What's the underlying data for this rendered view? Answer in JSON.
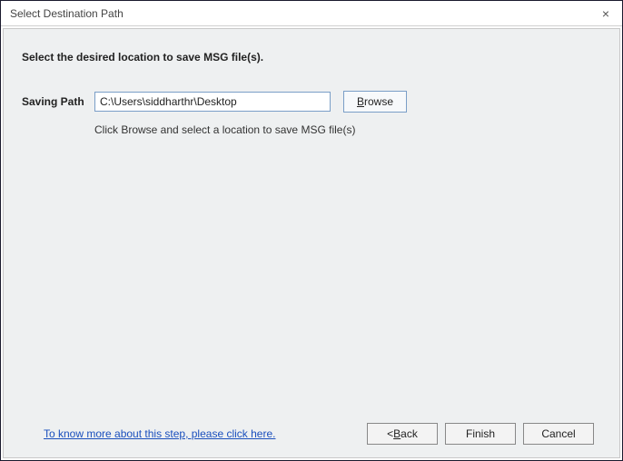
{
  "titlebar": {
    "title": "Select Destination Path",
    "close": "×"
  },
  "heading": "Select the desired location to save MSG file(s).",
  "form": {
    "saving_path_label": "Saving Path",
    "saving_path_value": "C:\\Users\\siddharthr\\Desktop",
    "browse_prefix": "B",
    "browse_rest": "rowse",
    "hint": "Click Browse and select a location to save MSG file(s)"
  },
  "footer": {
    "help_link": "To know more about this step, please click here.",
    "back_prefix": "< ",
    "back_u": "B",
    "back_rest": "ack",
    "finish": "Finish",
    "cancel": "Cancel"
  }
}
